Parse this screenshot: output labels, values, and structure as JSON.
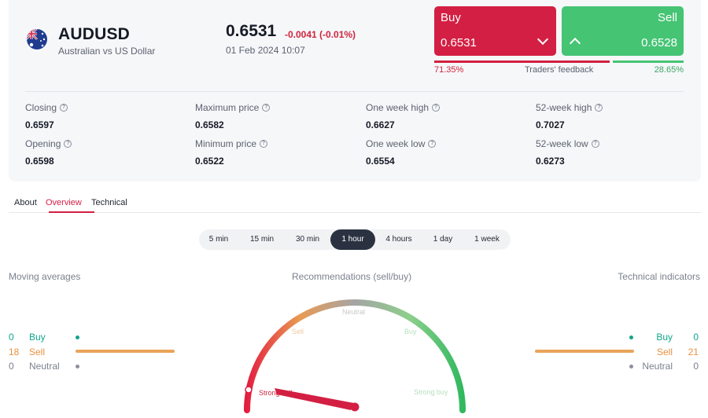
{
  "instrument": {
    "symbol": "AUDUSD",
    "name": "Australian vs US Dollar",
    "price": "0.6531",
    "change": "-0.0041 (-0.01%)",
    "datetime": "01 Feb 2024 10:07",
    "flag_icon": "australia-flag-icon"
  },
  "trade": {
    "buy_label": "Buy",
    "buy_price": "0.6531",
    "sell_label": "Sell",
    "sell_price": "0.6528",
    "buy_color": "#d31f43",
    "sell_color": "#45c474"
  },
  "feedback": {
    "label": "Traders' feedback",
    "buy_pct": "71.35%",
    "sell_pct": "28.65%",
    "buy_share": 71.35
  },
  "stats": {
    "closing": {
      "label": "Closing",
      "value": "0.6597"
    },
    "opening": {
      "label": "Opening",
      "value": "0.6598"
    },
    "max_price": {
      "label": "Maximum price",
      "value": "0.6582"
    },
    "min_price": {
      "label": "Minimum price",
      "value": "0.6522"
    },
    "week_high": {
      "label": "One week high",
      "value": "0.6627"
    },
    "week_low": {
      "label": "One week low",
      "value": "0.6554"
    },
    "year_high": {
      "label": "52-week high",
      "value": "0.7027"
    },
    "year_low": {
      "label": "52-week low",
      "value": "0.6273"
    },
    "info_icon": "question-circle-icon"
  },
  "tabs": [
    {
      "label": "About",
      "active": false
    },
    {
      "label": "Overview",
      "active": true
    },
    {
      "label": "Technical",
      "active": false
    }
  ],
  "timeframes": [
    {
      "label": "5 min",
      "active": false
    },
    {
      "label": "15 min",
      "active": false
    },
    {
      "label": "30 min",
      "active": false
    },
    {
      "label": "1 hour",
      "active": true
    },
    {
      "label": "4 hours",
      "active": false
    },
    {
      "label": "1 day",
      "active": false
    },
    {
      "label": "1 week",
      "active": false
    }
  ],
  "moving_averages": {
    "title": "Moving averages",
    "buy": {
      "count": "0",
      "label": "Buy"
    },
    "sell": {
      "count": "18",
      "label": "Sell"
    },
    "neutral": {
      "count": "0",
      "label": "Neutral"
    }
  },
  "technical_indicators": {
    "title": "Technical indicators",
    "buy": {
      "count": "0",
      "label": "Buy"
    },
    "sell": {
      "count": "21",
      "label": "Sell"
    },
    "neutral": {
      "count": "0",
      "label": "Neutral"
    }
  },
  "recommendations": {
    "title": "Recommendations (sell/buy)",
    "labels": {
      "strong_sell": "Strong sell",
      "sell": "Sell",
      "neutral": "Neutral",
      "buy": "Buy",
      "strong_buy": "Strong buy"
    },
    "current": "Strong sell"
  },
  "colors": {
    "buy": "#12a58a",
    "sell": "#e9903f",
    "neutral": "#7b818d"
  }
}
